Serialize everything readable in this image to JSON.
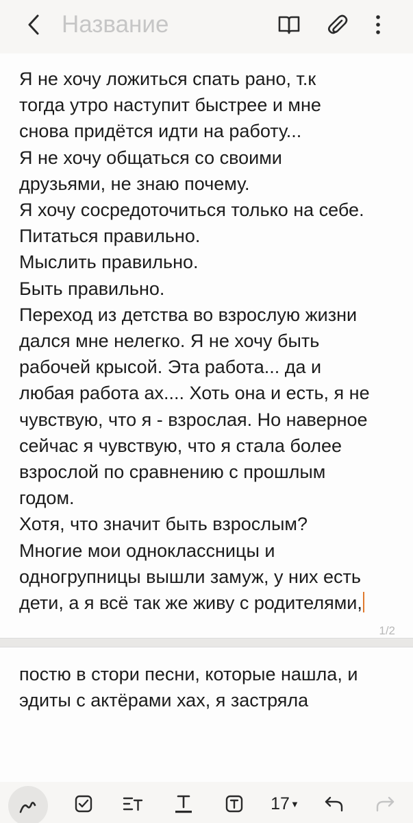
{
  "header": {
    "title_placeholder": "Название",
    "icons": {
      "back": "chevron-left-icon",
      "reading_mode": "book-icon",
      "attach": "paperclip-icon",
      "more": "more-vertical-icon"
    }
  },
  "note": {
    "page1_text": "Я не хочу ложиться спать рано, т.к\nтогда утро наступит быстрее и мне\nснова придётся идти на работу...\nЯ не хочу общаться со своими\nдрузьями, не знаю почему.\nЯ хочу сосредоточиться только на себе.\nПитаться правильно.\nМыслить правильно.\nБыть правильно.\nПереход из детства во взрослую жизни\nдался мне нелегко. Я не хочу быть\nрабочей крысой. Эта работа... да и\nлюбая работа ах.... Хоть она и есть, я не\nчувствую, что я - взрослая. Но наверное\nсейчас я чувствую, что я стала более\nвзрослой по сравнению с прошлым\nгодом.\nХотя, что значит быть взрослым?\nМногие мои одноклассницы и\nодногрупницы вышли замуж, у них есть\nдети, а я всё так же живу с родителями,",
    "page_indicator": "1/2",
    "page2_text": "постю в стори песни, которые нашла, и\nэдиты с актёрами хах, я застряла",
    "accent_color": "#e07a2e"
  },
  "toolbar": {
    "font_size": "17",
    "icons": [
      "pen-icon",
      "checkbox-icon",
      "indent-icon",
      "text-style-icon",
      "text-box-icon",
      "undo-icon",
      "redo-icon"
    ]
  }
}
